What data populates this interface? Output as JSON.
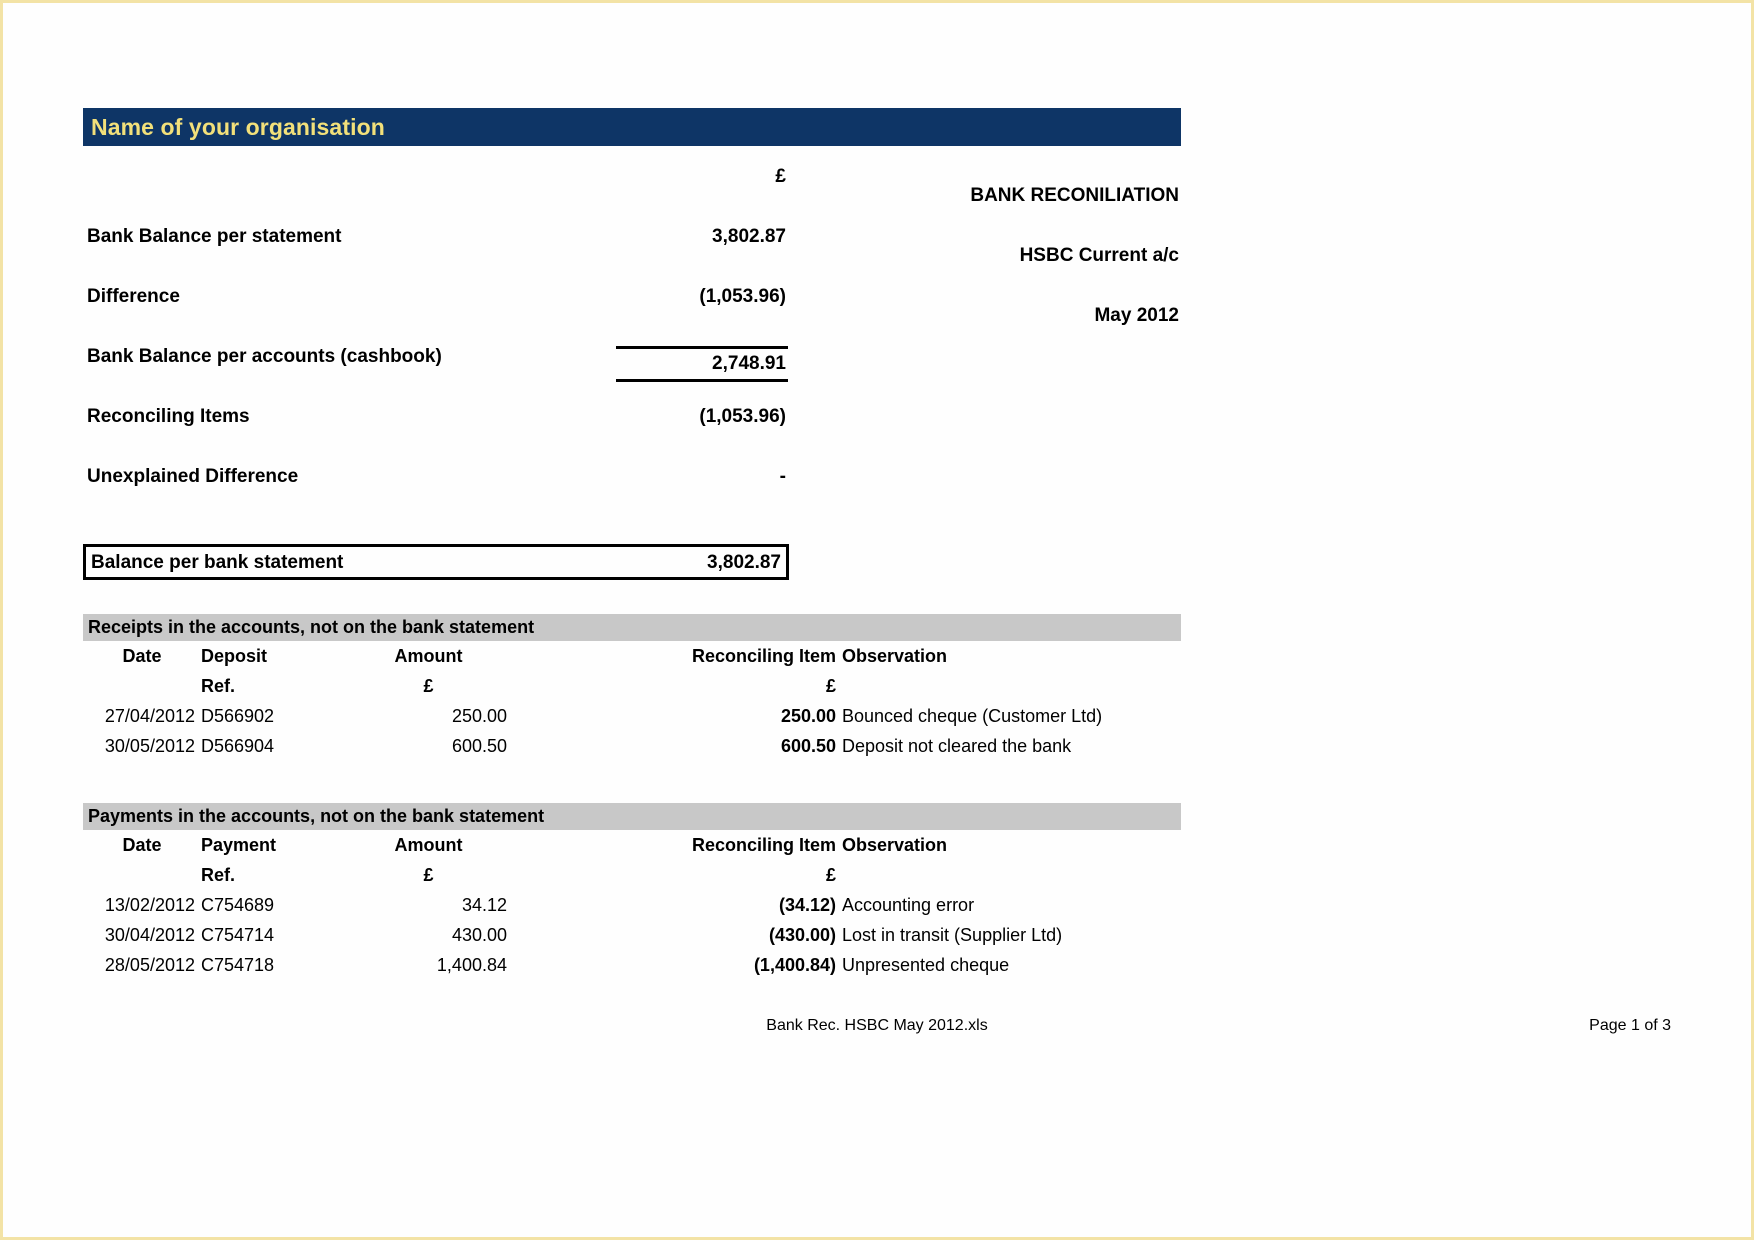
{
  "header": {
    "organisation_name": "Name of your organisation",
    "bar_color": "#0e3566",
    "text_color": "#f2e07a"
  },
  "document_title": {
    "line1": "BANK RECONILIATION",
    "line2": "HSBC Current a/c",
    "line3": "May 2012"
  },
  "summary": {
    "currency_symbol": "£",
    "rows": [
      {
        "label": "Bank Balance per statement",
        "value": "3,802.87"
      },
      {
        "label": "Difference",
        "value": "(1,053.96)"
      },
      {
        "label": "Bank Balance per accounts (cashbook)",
        "value": "2,748.91"
      },
      {
        "label": "Reconciling Items",
        "value": "(1,053.96)"
      },
      {
        "label": "Unexplained Difference",
        "value": "-"
      }
    ],
    "boxed": {
      "label": "Balance per bank statement",
      "value": "3,802.87"
    }
  },
  "receipts": {
    "band_title": "Receipts in the accounts, not on the bank statement",
    "headers": {
      "date": "Date",
      "ref": "Deposit",
      "ref2": "Ref.",
      "amount": "Amount",
      "amount2": "£",
      "reconciling": "Reconciling Item",
      "reconciling2": "£",
      "observation": "Observation"
    },
    "rows": [
      {
        "date": "27/04/2012",
        "ref": "D566902",
        "amount": "250.00",
        "reconciling": "250.00",
        "observation": "Bounced cheque (Customer Ltd)"
      },
      {
        "date": "30/05/2012",
        "ref": "D566904",
        "amount": "600.50",
        "reconciling": "600.50",
        "observation": "Deposit not cleared the bank"
      }
    ]
  },
  "payments": {
    "band_title": "Payments in the accounts, not on the bank statement",
    "headers": {
      "date": "Date",
      "ref": "Payment",
      "ref2": "Ref.",
      "amount": "Amount",
      "amount2": "£",
      "reconciling": "Reconciling Item",
      "reconciling2": "£",
      "observation": "Observation"
    },
    "rows": [
      {
        "date": "13/02/2012",
        "ref": "C754689",
        "amount": "34.12",
        "reconciling": "(34.12)",
        "observation": "Accounting error"
      },
      {
        "date": "30/04/2012",
        "ref": "C754714",
        "amount": "430.00",
        "reconciling": "(430.00)",
        "observation": "Lost in transit (Supplier Ltd)"
      },
      {
        "date": "28/05/2012",
        "ref": "C754718",
        "amount": "1,400.84",
        "reconciling": "(1,400.84)",
        "observation": "Unpresented cheque"
      }
    ]
  },
  "footer": {
    "file_name": "Bank Rec. HSBC May 2012.xls",
    "page_label": "Page 1 of 3"
  }
}
